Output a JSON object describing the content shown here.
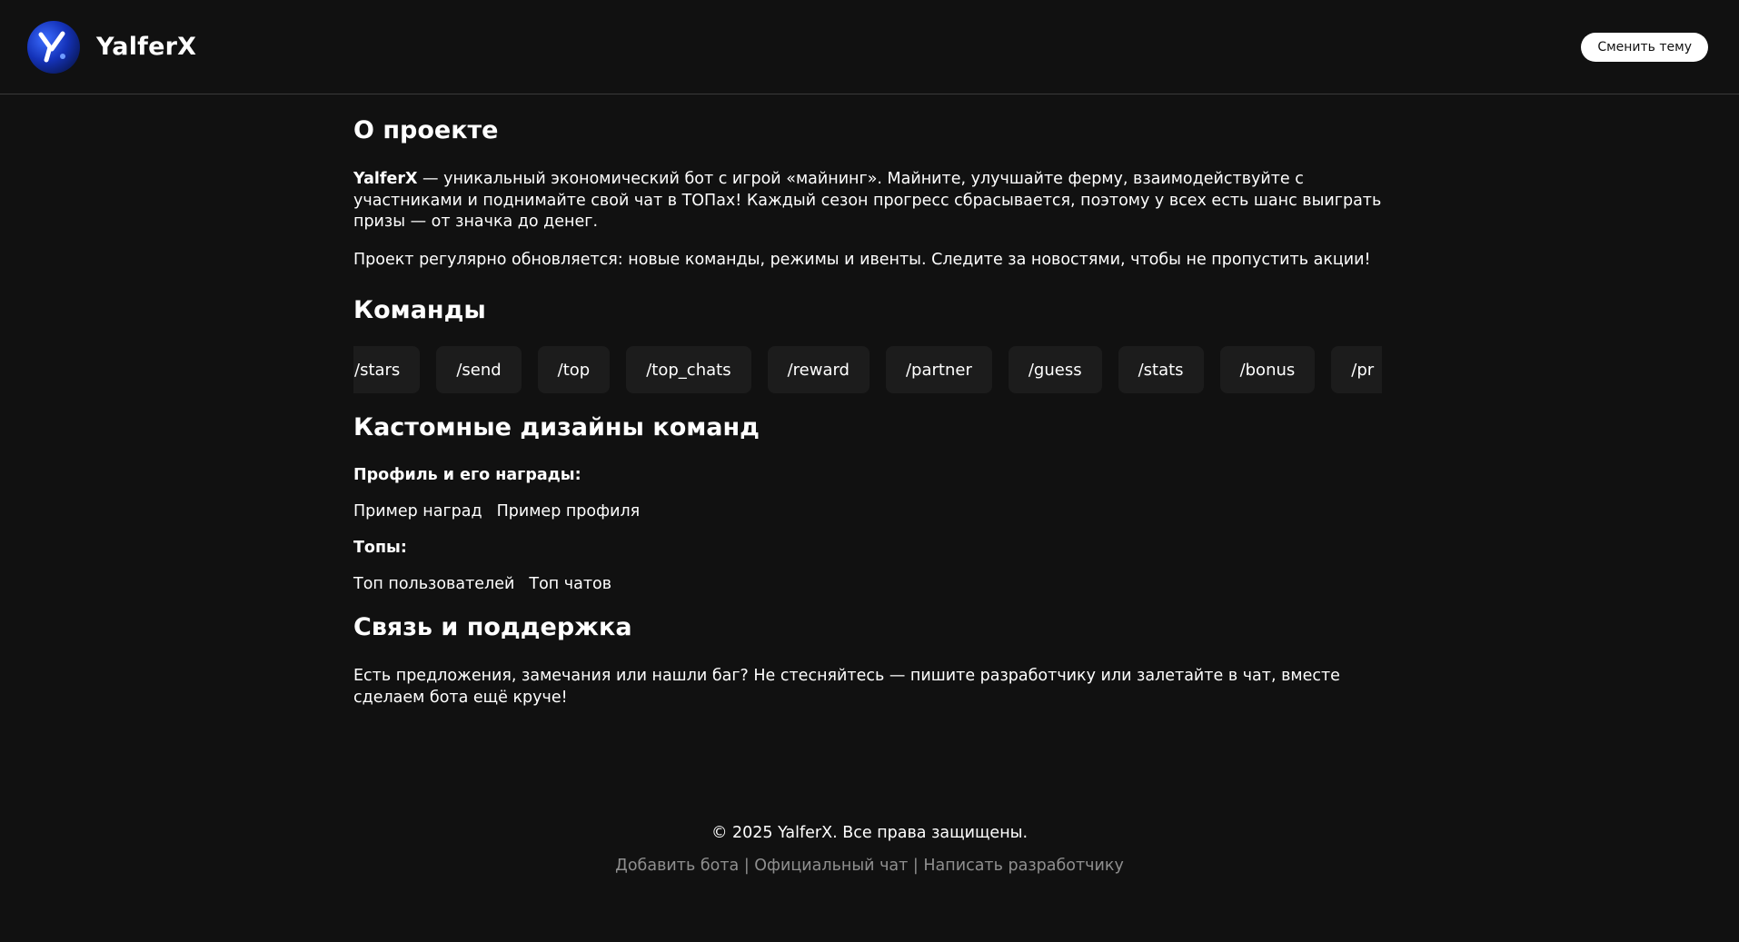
{
  "header": {
    "brand": "YalferX",
    "theme_button": "Сменить тему"
  },
  "about": {
    "title": "О проекте",
    "para1_bold": "YalferX",
    "para1_rest": " — уникальный экономический бот с игрой «майнинг». Майните, улучшайте ферму, взаимодействуйте с участниками и поднимайте свой чат в ТОПах! Каждый сезон прогресс сбрасывается, поэтому у всех есть шанс выиграть призы — от значка до денег.",
    "para2": "Проект регулярно обновляется: новые команды, режимы и ивенты. Следите за новостями, чтобы не пропустить акции!"
  },
  "commands": {
    "title": "Команды",
    "items": [
      "/stars",
      "/send",
      "/top",
      "/top_chats",
      "/reward",
      "/partner",
      "/guess",
      "/stats",
      "/bonus",
      "/pr"
    ]
  },
  "designs": {
    "title": "Кастомные дизайны команд",
    "profile_heading": "Профиль и его награды:",
    "profile_links": [
      "Пример наград",
      "Пример профиля"
    ],
    "tops_heading": "Топы:",
    "tops_links": [
      "Топ пользователей",
      "Топ чатов"
    ]
  },
  "support": {
    "title": "Связь и поддержка",
    "text": "Есть предложения, замечания или нашли баг? Не стесняйтесь — пишите разработчику или залетайте в чат, вместе сделаем бота ещё круче!"
  },
  "footer": {
    "copyright": "© 2025 YalferX. Все права защищены.",
    "links": [
      "Добавить бота",
      "Официальный чат",
      "Написать разработчику"
    ],
    "separator": " | "
  },
  "colors": {
    "background": "#111111",
    "card": "#1c1c1c",
    "muted": "#8f8f8f"
  }
}
